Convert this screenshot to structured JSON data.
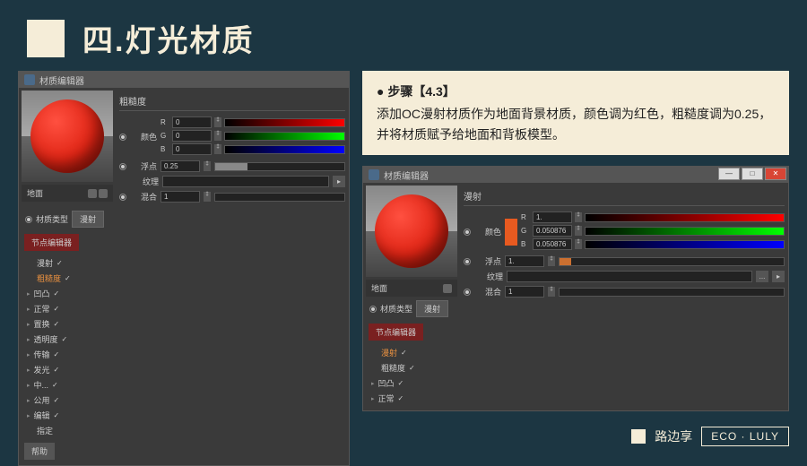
{
  "header": {
    "title": "四.灯光材质"
  },
  "step": {
    "title": "● 步骤【4.3】",
    "desc": "添加OC漫射材质作为地面背景材质，颜色调为红色，粗糙度调为0.25，并将材质赋予给地面和背板模型。"
  },
  "editor1": {
    "title": "材质编辑器",
    "material_name": "地面",
    "mat_type_label": "材质类型",
    "mat_type_value": "漫射",
    "node_editor_btn": "节点编辑器",
    "section": "粗糙度",
    "props": [
      {
        "label": "漫射",
        "checked": true,
        "active": false
      },
      {
        "label": "粗糙度",
        "checked": true,
        "active": true
      },
      {
        "label": "凹凸",
        "checked": true,
        "active": false,
        "expandable": true
      },
      {
        "label": "正常",
        "checked": true,
        "active": false,
        "expandable": true
      },
      {
        "label": "置换",
        "checked": true,
        "active": false,
        "expandable": true
      },
      {
        "label": "透明度",
        "checked": true,
        "active": false,
        "expandable": true
      },
      {
        "label": "传输",
        "checked": true,
        "active": false,
        "expandable": true
      },
      {
        "label": "发光",
        "checked": true,
        "active": false,
        "expandable": true
      },
      {
        "label": "中...",
        "checked": true,
        "active": false,
        "expandable": true
      },
      {
        "label": "公用",
        "checked": true,
        "active": false,
        "expandable": true
      },
      {
        "label": "编辑",
        "checked": true,
        "active": false,
        "expandable": true
      },
      {
        "label": "指定",
        "checked": false,
        "active": false
      }
    ],
    "color_label": "颜色",
    "rgb": {
      "r": "0",
      "g": "0",
      "b": "0"
    },
    "float_label": "浮点",
    "float_value": "0.25",
    "texture_label": "纹理",
    "blend_label": "混合",
    "blend_value": "1",
    "help_btn": "帮助"
  },
  "editor2": {
    "title": "材质编辑器",
    "material_name": "地面",
    "mat_type_label": "材质类型",
    "mat_type_value": "漫射",
    "node_editor_btn": "节点编辑器",
    "section": "漫射",
    "props": [
      {
        "label": "漫射",
        "checked": true,
        "active": true
      },
      {
        "label": "粗糙度",
        "checked": true,
        "active": false
      },
      {
        "label": "凹凸",
        "checked": true,
        "active": false,
        "expandable": true
      },
      {
        "label": "正常",
        "checked": true,
        "active": false,
        "expandable": true
      }
    ],
    "color_label": "颜色",
    "rgb": {
      "r": "1.",
      "g": "0.050876",
      "b": "0.050876"
    },
    "float_label": "浮点",
    "float_value": "1.",
    "texture_label": "纹理",
    "blend_label": "混合",
    "blend_value": "1"
  },
  "footer": {
    "author": "路边享",
    "brand": "ECO · LULY"
  }
}
